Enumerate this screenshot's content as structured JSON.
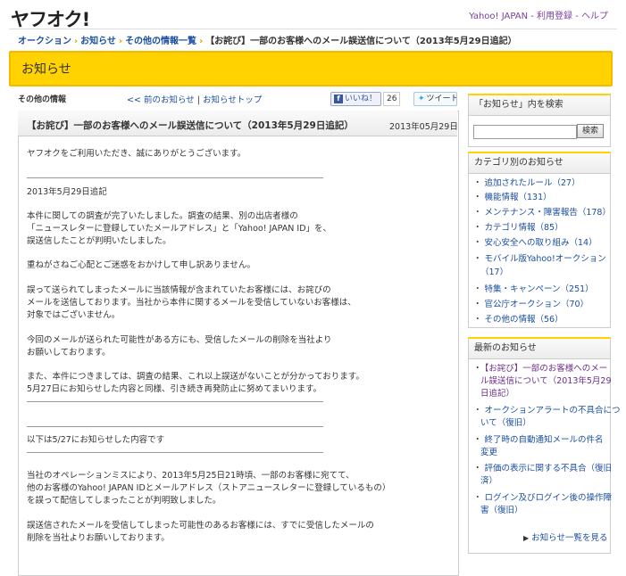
{
  "header": {
    "logo": "ヤフオク!",
    "links": [
      "Yahoo! JAPAN",
      "利用登録",
      "ヘルプ"
    ],
    "separator": " - "
  },
  "breadcrumb": {
    "items": [
      "オークション",
      "お知らせ",
      "その他の情報一覧"
    ],
    "current": "【お詫び】一部のお客様へのメール誤送信について（2013年5月29日追記）"
  },
  "page_title": "お知らせ",
  "subnav": {
    "category": "その他の情報",
    "prev": "<< 前のお知らせ",
    "divider": "|",
    "top": "お知らせトップ",
    "like_label": "いいね！",
    "like_count": "26",
    "tweet_label": "ツイート"
  },
  "article": {
    "title": "【お詫び】一部のお客様へのメール誤送信について（2013年5月29日追記）",
    "date": "2013年05月29日",
    "paragraphs": [
      "ヤフオクをご利用いただき、誠にありがとうございます。",
      "2013年5月29日追記",
      "本件に関しての調査が完了いたしました。調査の結果、別の出店者様の",
      "「ニュースレターに登録していたメールアドレス」と「Yahoo! JAPAN ID」を、",
      "誤送信したことが判明いたしました。",
      "重ねがさねご心配とご迷惑をおかけして申し訳ありません。",
      "誤って送られてしまったメールに当該情報が含まれていたお客様には、お詫びの",
      "メールを送信しております。当社から本件に関するメールを受信していないお客様は、",
      "対象ではございません。",
      "今回のメールが送られた可能性がある方にも、受信したメールの削除を当社より",
      "お願いしております。",
      "また、本件につきましては、調査の結果、これ以上誤送がないことが分かっております。",
      "5月27日にお知らせした内容と同様、引き続き再発防止に努めてまいります。",
      "以下は5/27にお知らせした内容です",
      "当社のオペレーションミスにより、2013年5月25日21時頃、一部のお客様に宛てて、",
      "他のお客様のYahoo! JAPAN IDとメールアドレス（ストアニュースレターに登録しているもの）",
      "を誤って配信してしまったことが判明致しました。",
      "誤送信されたメールを受信してしまった可能性のあるお客様には、すでに受信したメールの",
      "削除を当社よりお願いしております。"
    ]
  },
  "sidebar": {
    "search": {
      "heading": "「お知らせ」内を検索",
      "button": "検索",
      "value": ""
    },
    "categories": {
      "heading": "カテゴリ別のお知らせ",
      "items": [
        "追加されたルール（27）",
        "機能情報（131）",
        "メンテナンス・障害報告（178）",
        "カテゴリ情報（85）",
        "安心安全への取り組み（14）",
        "モバイル版Yahoo!オークション",
        "（17）",
        "特集・キャンペーン（251）",
        "官公庁オークション（70）",
        "その他の情報（56）"
      ]
    },
    "latest": {
      "heading": "最新のお知らせ",
      "items": [
        "【お詫び】一部のお客様へのメー",
        "ル誤送信について（2013年5月29",
        "日追記）",
        "オークションアラートの不具合につ",
        "いて（復旧）",
        "終了時の自動通知メールの件名",
        "変更",
        "評価の表示に関する不具合（復旧",
        "済）",
        "ログイン及びログイン後の操作障",
        "害（復旧）"
      ],
      "more": "お知らせ一覧を見る"
    }
  }
}
